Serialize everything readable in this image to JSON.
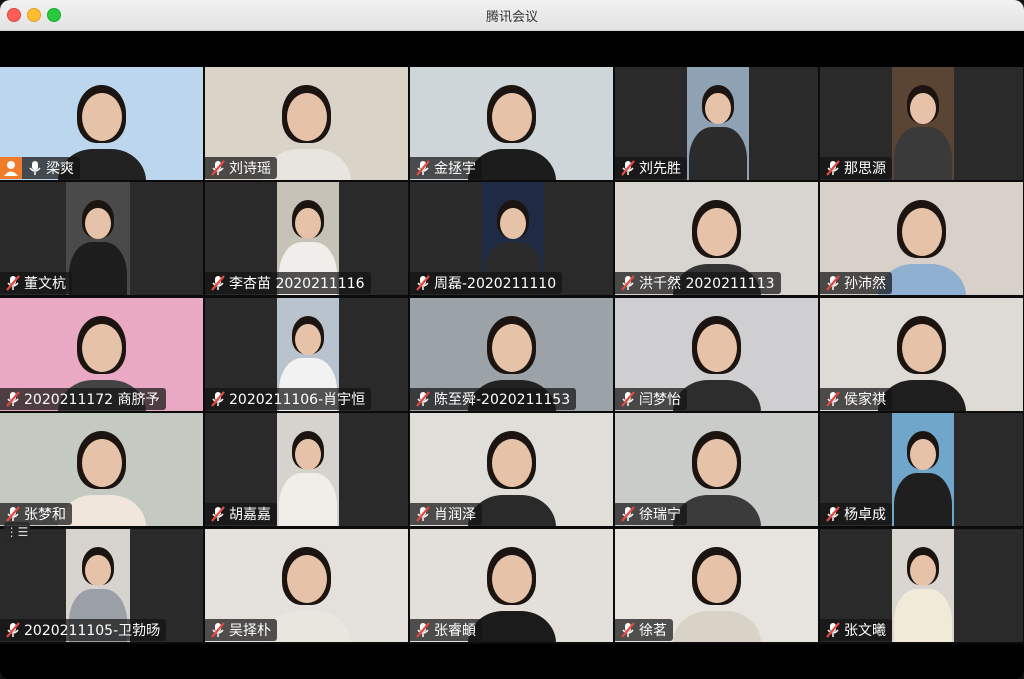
{
  "window": {
    "title": "腾讯会议"
  },
  "participants": [
    {
      "name": "梁爽",
      "mic": "on",
      "host": true,
      "bg": "#bcd6ee"
    },
    {
      "name": "刘诗瑶",
      "mic": "muted",
      "bg": "#d9d3c8"
    },
    {
      "name": "金拯宇",
      "mic": "muted",
      "bg": "#cfd6d9"
    },
    {
      "name": "刘先胜",
      "mic": "muted",
      "bg": "#8fa2b3"
    },
    {
      "name": "那思源",
      "mic": "muted",
      "bg": "#5a4433"
    },
    {
      "name": "董文杭",
      "mic": "muted",
      "bg": "#4a4a4a"
    },
    {
      "name": "李杏苗 2020211116",
      "mic": "muted",
      "bg": "#c7c2b8"
    },
    {
      "name": "周磊-2020211110",
      "mic": "muted",
      "bg": "#1f2a44"
    },
    {
      "name": "洪千然 2020211113",
      "mic": "muted",
      "bg": "#d8d4cf"
    },
    {
      "name": "孙沛然",
      "mic": "muted",
      "bg": "#d7d1c9"
    },
    {
      "name": "2020211172 商脐予",
      "mic": "muted",
      "bg": "#e9a9c2"
    },
    {
      "name": "2020211106-肖宇恒",
      "mic": "muted",
      "bg": "#b9c3cd"
    },
    {
      "name": "陈至舜-2020211153",
      "mic": "muted",
      "bg": "#9ba3a9"
    },
    {
      "name": "闫梦怡",
      "mic": "muted",
      "bg": "#cfcfd1"
    },
    {
      "name": "侯家祺",
      "mic": "muted",
      "bg": "#dedad5"
    },
    {
      "name": "张梦和",
      "mic": "muted",
      "bg": "#c4c9c1"
    },
    {
      "name": "胡嘉嘉",
      "mic": "muted",
      "bg": "#d6d3cf"
    },
    {
      "name": "肖润泽",
      "mic": "muted",
      "bg": "#e0ded9"
    },
    {
      "name": "徐瑞宁",
      "mic": "muted",
      "bg": "#c9ccc8"
    },
    {
      "name": "杨卓成",
      "mic": "muted",
      "bg": "#6fa6c9"
    },
    {
      "name": "2020211105-卫勃旸",
      "mic": "muted",
      "bg": "#d7d4cf"
    },
    {
      "name": "吴择朴",
      "mic": "muted",
      "bg": "#e4e1dc"
    },
    {
      "name": "张睿頔",
      "mic": "muted",
      "bg": "#e3e0dc"
    },
    {
      "name": "徐茗",
      "mic": "muted",
      "bg": "#e7e4e0"
    },
    {
      "name": "张文曦",
      "mic": "muted",
      "bg": "#d9d6d2"
    }
  ],
  "colors": {
    "muted_mic": "#e5483f",
    "host_badge": "#f07b2a",
    "tile_bg": "#2a2a2a"
  },
  "side_handle_icon": "list-icon"
}
